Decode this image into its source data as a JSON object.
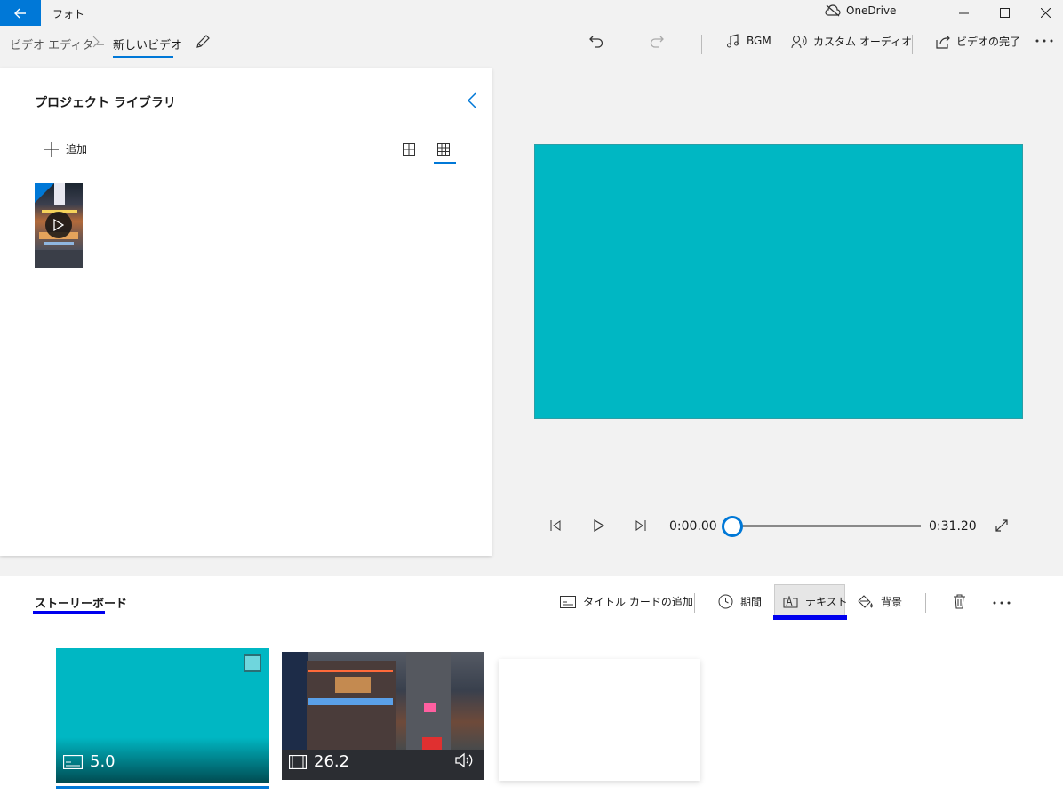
{
  "titlebar": {
    "app_name": "フォト",
    "onedrive": "OneDrive"
  },
  "breadcrumb": {
    "root": "ビデオ エディター",
    "current": "新しいビデオ"
  },
  "toolbar": {
    "bgm": "BGM",
    "custom_audio": "カスタム オーディオ",
    "finish_video": "ビデオの完了"
  },
  "library": {
    "title": "プロジェクト ライブラリ",
    "add_label": "追加"
  },
  "player": {
    "current_time": "0:00.00",
    "total_time": "0:31.20",
    "progress": 0
  },
  "storyboard": {
    "title": "ストーリーボード",
    "tools": {
      "add_title_card": "タイトル カードの追加",
      "duration": "期間",
      "text": "テキスト",
      "background": "背景"
    },
    "clips": [
      {
        "kind": "title-card",
        "duration": "5.0"
      },
      {
        "kind": "video",
        "duration": "26.2"
      }
    ]
  },
  "colors": {
    "accent": "#0078d7",
    "title_card": "#00b7c3",
    "highlight": "#0000ee"
  },
  "icons": [
    "back-arrow-icon",
    "cloud-off-icon",
    "minimize-icon",
    "maximize-icon",
    "close-icon",
    "pencil-icon",
    "undo-icon",
    "redo-icon",
    "music-note-icon",
    "person-audio-icon",
    "share-icon",
    "more-icon",
    "chevron-left-icon",
    "plus-icon",
    "grid-large-icon",
    "grid-small-icon",
    "play-icon",
    "step-back-icon",
    "step-forward-icon",
    "fullscreen-icon",
    "title-card-icon",
    "clock-icon",
    "text-icon",
    "paint-bucket-icon",
    "trash-icon",
    "film-icon",
    "speaker-icon"
  ]
}
